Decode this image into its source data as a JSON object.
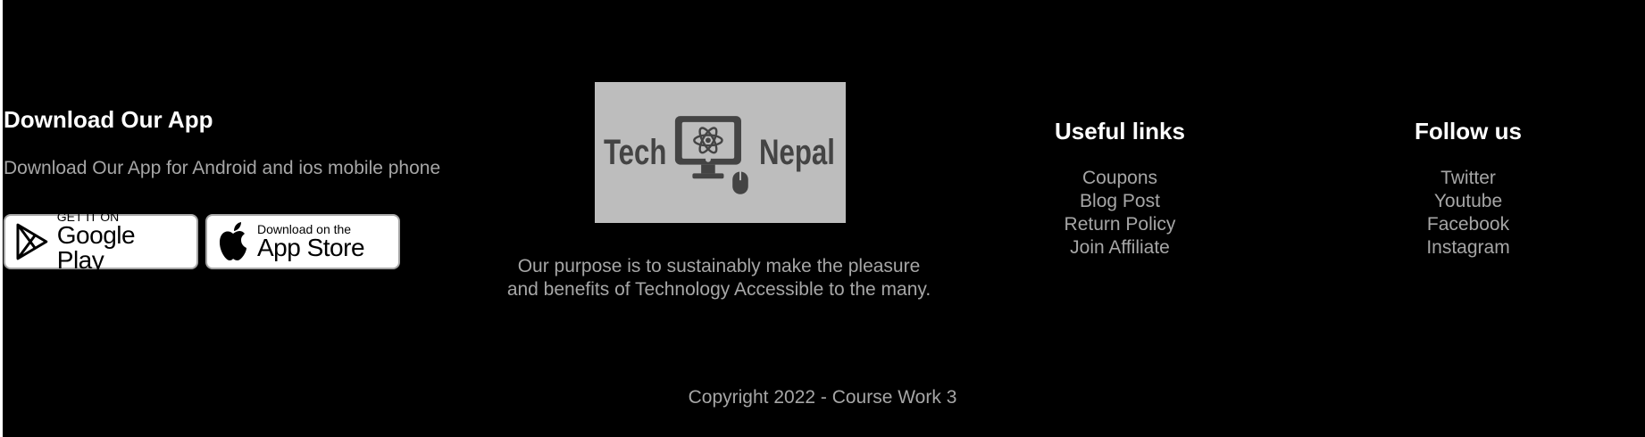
{
  "download": {
    "title": "Download Our App",
    "description": "Download Our App for Android and ios mobile phone",
    "google_play": {
      "small": "GET IT ON",
      "big": "Google Play"
    },
    "app_store": {
      "small": "Download on the",
      "big": "App Store"
    }
  },
  "logo": {
    "left_word": "Tech",
    "right_word": "Nepal"
  },
  "purpose": {
    "line1": "Our purpose is to sustainably make the pleasure",
    "line2": "and benefits of Technology Accessible to the many."
  },
  "useful_links": {
    "title": "Useful links",
    "items": [
      "Coupons",
      "Blog Post",
      "Return Policy",
      "Join Affiliate"
    ]
  },
  "follow_us": {
    "title": "Follow us",
    "items": [
      "Twitter",
      "Youtube",
      "Facebook",
      "Instagram"
    ]
  },
  "copyright": "Copyright 2022 - Course Work 3",
  "colors": {
    "background": "#000000",
    "heading": "#ffffff",
    "text": "#a6a6a6",
    "logo_bg": "#bdbdbd"
  }
}
